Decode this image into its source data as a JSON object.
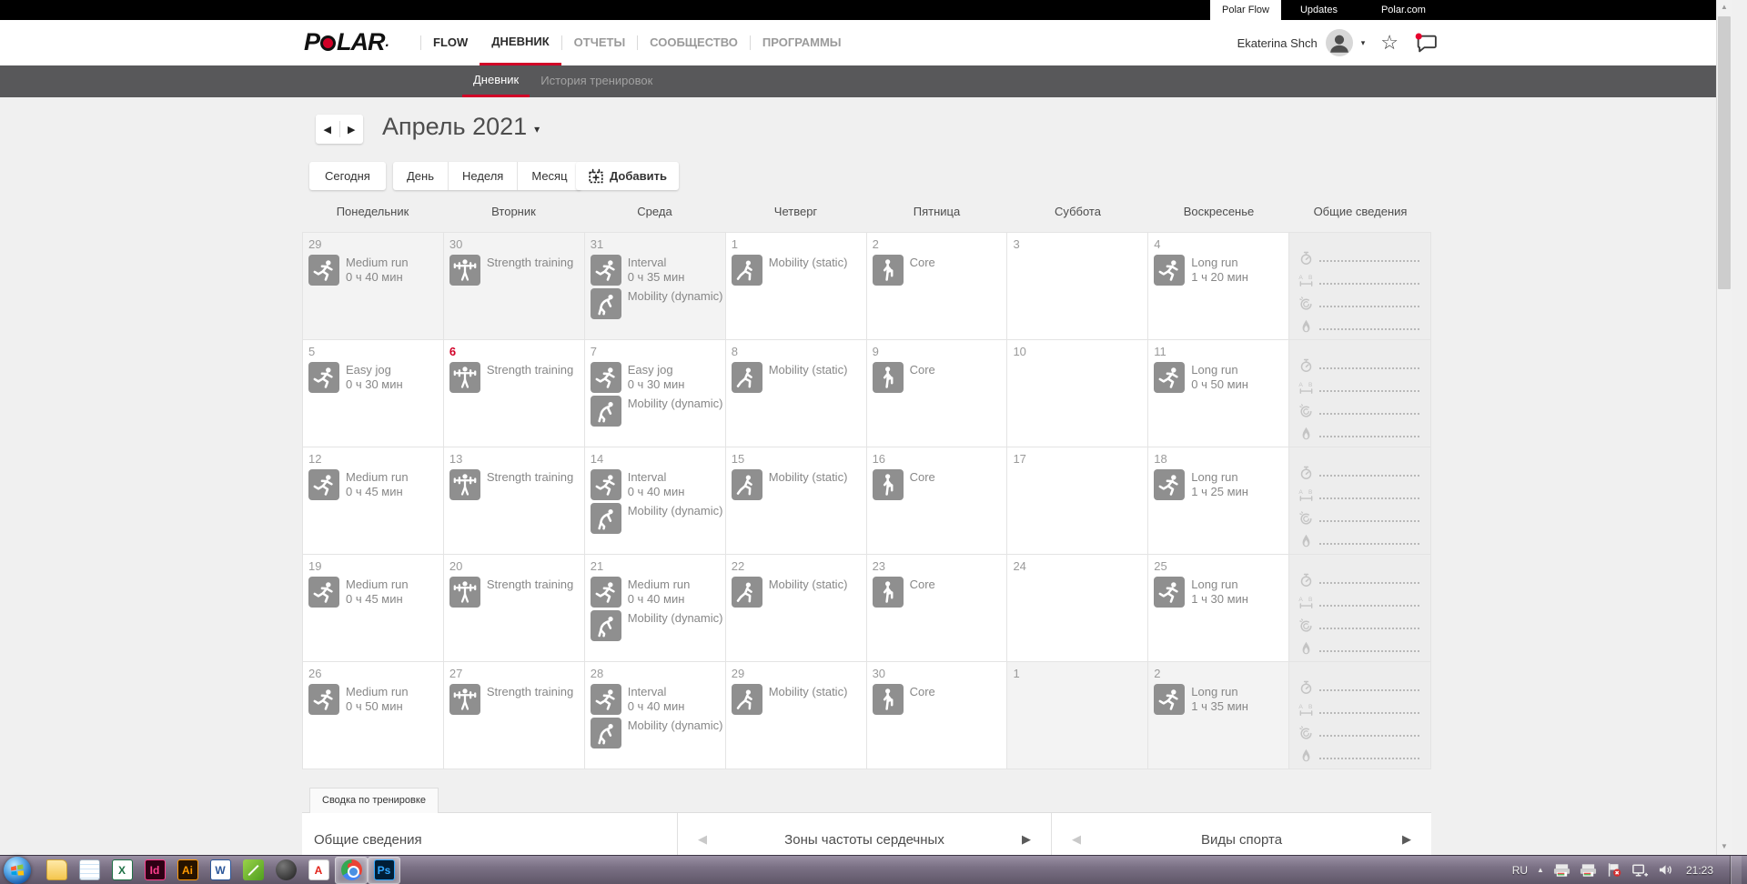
{
  "browser_bar": {
    "tabs": [
      {
        "label": "Polar Flow",
        "active": true
      },
      {
        "label": "Updates",
        "active": false
      },
      {
        "label": "Polar.com",
        "active": false
      }
    ]
  },
  "nav": {
    "logo": "POLAR",
    "items": [
      {
        "label": "FLOW",
        "style": "strong",
        "sep_before": true
      },
      {
        "label": "ДНЕВНИК",
        "style": "active",
        "sep_before": false
      },
      {
        "label": "ОТЧЕТЫ",
        "style": "",
        "sep_before": true
      },
      {
        "label": "СООБЩЕСТВО",
        "style": "",
        "sep_before": true
      },
      {
        "label": "ПРОГРАММЫ",
        "style": "",
        "sep_before": true
      }
    ],
    "user": {
      "name": "Ekaterina Shch"
    }
  },
  "subnav": {
    "items": [
      {
        "label": "Дневник",
        "active": true
      },
      {
        "label": "История тренировок",
        "active": false
      }
    ]
  },
  "toolbar": {
    "month_title": "Апрель 2021",
    "today_label": "Сегодня",
    "view_labels": [
      "День",
      "Неделя",
      "Месяц"
    ],
    "add_label": "Добавить"
  },
  "calendar": {
    "day_headers": [
      "Понедельник",
      "Вторник",
      "Среда",
      "Четверг",
      "Пятница",
      "Суббота",
      "Воскресенье",
      "Общие сведения"
    ],
    "summary_icons": [
      "duration",
      "distance",
      "training-load",
      "calories"
    ],
    "weeks": [
      {
        "days": [
          {
            "num": "29",
            "muted": true,
            "events": [
              {
                "icon": "run",
                "title": "Medium run",
                "duration": "0 ч 40 мин"
              }
            ]
          },
          {
            "num": "30",
            "muted": true,
            "events": [
              {
                "icon": "strength",
                "title": "Strength training"
              }
            ]
          },
          {
            "num": "31",
            "muted": true,
            "events": [
              {
                "icon": "run",
                "title": "Interval",
                "duration": "0 ч 35 мин"
              },
              {
                "icon": "mobility-dynamic",
                "title": "Mobility (dynamic)"
              }
            ]
          },
          {
            "num": "1",
            "events": [
              {
                "icon": "mobility-static",
                "title": "Mobility (static)"
              }
            ]
          },
          {
            "num": "2",
            "events": [
              {
                "icon": "core",
                "title": "Core"
              }
            ]
          },
          {
            "num": "3",
            "events": []
          },
          {
            "num": "4",
            "events": [
              {
                "icon": "run",
                "title": "Long run",
                "duration": "1 ч 20 мин"
              }
            ]
          }
        ]
      },
      {
        "days": [
          {
            "num": "5",
            "events": [
              {
                "icon": "run",
                "title": "Easy jog",
                "duration": "0 ч 30 мин"
              }
            ]
          },
          {
            "num": "6",
            "today": true,
            "events": [
              {
                "icon": "strength",
                "title": "Strength training"
              }
            ]
          },
          {
            "num": "7",
            "events": [
              {
                "icon": "run",
                "title": "Easy jog",
                "duration": "0 ч 30 мин"
              },
              {
                "icon": "mobility-dynamic",
                "title": "Mobility (dynamic)"
              }
            ]
          },
          {
            "num": "8",
            "events": [
              {
                "icon": "mobility-static",
                "title": "Mobility (static)"
              }
            ]
          },
          {
            "num": "9",
            "events": [
              {
                "icon": "core",
                "title": "Core"
              }
            ]
          },
          {
            "num": "10",
            "events": []
          },
          {
            "num": "11",
            "events": [
              {
                "icon": "run",
                "title": "Long run",
                "duration": "0 ч 50 мин"
              }
            ]
          }
        ]
      },
      {
        "days": [
          {
            "num": "12",
            "events": [
              {
                "icon": "run",
                "title": "Medium run",
                "duration": "0 ч 45 мин"
              }
            ]
          },
          {
            "num": "13",
            "events": [
              {
                "icon": "strength",
                "title": "Strength training"
              }
            ]
          },
          {
            "num": "14",
            "events": [
              {
                "icon": "run",
                "title": "Interval",
                "duration": "0 ч 40 мин"
              },
              {
                "icon": "mobility-dynamic",
                "title": "Mobility (dynamic)"
              }
            ]
          },
          {
            "num": "15",
            "events": [
              {
                "icon": "mobility-static",
                "title": "Mobility (static)"
              }
            ]
          },
          {
            "num": "16",
            "events": [
              {
                "icon": "core",
                "title": "Core"
              }
            ]
          },
          {
            "num": "17",
            "events": []
          },
          {
            "num": "18",
            "events": [
              {
                "icon": "run",
                "title": "Long run",
                "duration": "1 ч 25 мин"
              }
            ]
          }
        ]
      },
      {
        "days": [
          {
            "num": "19",
            "events": [
              {
                "icon": "run",
                "title": "Medium run",
                "duration": "0 ч 45 мин"
              }
            ]
          },
          {
            "num": "20",
            "events": [
              {
                "icon": "strength",
                "title": "Strength training"
              }
            ]
          },
          {
            "num": "21",
            "events": [
              {
                "icon": "run",
                "title": "Medium run",
                "duration": "0 ч 40 мин"
              },
              {
                "icon": "mobility-dynamic",
                "title": "Mobility (dynamic)"
              }
            ]
          },
          {
            "num": "22",
            "events": [
              {
                "icon": "mobility-static",
                "title": "Mobility (static)"
              }
            ]
          },
          {
            "num": "23",
            "events": [
              {
                "icon": "core",
                "title": "Core"
              }
            ]
          },
          {
            "num": "24",
            "events": []
          },
          {
            "num": "25",
            "events": [
              {
                "icon": "run",
                "title": "Long run",
                "duration": "1 ч 30 мин"
              }
            ]
          }
        ]
      },
      {
        "days": [
          {
            "num": "26",
            "events": [
              {
                "icon": "run",
                "title": "Medium run",
                "duration": "0 ч 50 мин"
              }
            ]
          },
          {
            "num": "27",
            "events": [
              {
                "icon": "strength",
                "title": "Strength training"
              }
            ]
          },
          {
            "num": "28",
            "events": [
              {
                "icon": "run",
                "title": "Interval",
                "duration": "0 ч 40 мин"
              },
              {
                "icon": "mobility-dynamic",
                "title": "Mobility (dynamic)"
              }
            ]
          },
          {
            "num": "29",
            "events": [
              {
                "icon": "mobility-static",
                "title": "Mobility (static)"
              }
            ]
          },
          {
            "num": "30",
            "events": [
              {
                "icon": "core",
                "title": "Core"
              }
            ]
          },
          {
            "num": "1",
            "muted": true,
            "events": []
          },
          {
            "num": "2",
            "muted": true,
            "events": [
              {
                "icon": "run",
                "title": "Long run",
                "duration": "1 ч 35 мин"
              }
            ]
          }
        ]
      }
    ]
  },
  "summary_panel": {
    "tab_label": "Сводка по тренировке",
    "sections": [
      {
        "title": "Общие сведения",
        "arrows": false
      },
      {
        "title": "Зоны частоты сердечных",
        "arrows": true
      },
      {
        "title": "Виды спорта",
        "arrows": true
      }
    ]
  },
  "taskbar": {
    "language": "RU",
    "clock": "21:23",
    "apps": [
      {
        "id": "explorer",
        "label": ""
      },
      {
        "id": "notepad",
        "label": ""
      },
      {
        "id": "excel",
        "label": "X"
      },
      {
        "id": "indesign",
        "label": "Id"
      },
      {
        "id": "illustrator",
        "label": "Ai"
      },
      {
        "id": "word",
        "label": "W"
      },
      {
        "id": "green",
        "label": ""
      },
      {
        "id": "dark",
        "label": ""
      },
      {
        "id": "acrobat",
        "label": "A"
      },
      {
        "id": "chrome",
        "label": "",
        "active": true
      },
      {
        "id": "photoshop",
        "label": "Ps",
        "active": true
      }
    ]
  },
  "colors": {
    "accent_red": "#d10027",
    "subnav_bg": "#58585a",
    "event_icon_gray": "#8f8f8f"
  }
}
